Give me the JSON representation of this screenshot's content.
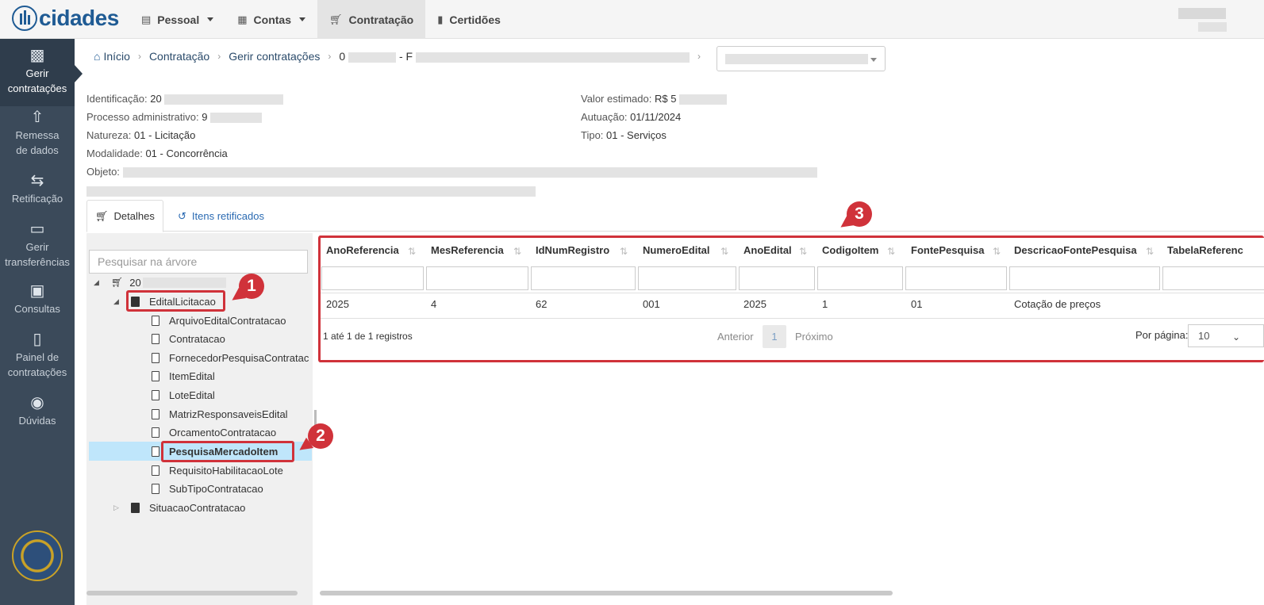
{
  "header": {
    "logo_text": "cidades",
    "nav": [
      {
        "label": "Pessoal",
        "icon": "id-card-icon"
      },
      {
        "label": "Contas",
        "icon": "calendar-icon"
      },
      {
        "label": "Contratação",
        "icon": "cart-icon"
      },
      {
        "label": "Certidões",
        "icon": "file-icon"
      }
    ]
  },
  "sidebar": {
    "items": [
      {
        "label_1": "Gerir",
        "label_2": "contratações",
        "icon": "building-icon"
      },
      {
        "label_1": "Remessa",
        "label_2": "de dados",
        "icon": "upload-icon"
      },
      {
        "label_1": "Retificação",
        "label_2": "",
        "icon": "swap-icon"
      },
      {
        "label_1": "Gerir",
        "label_2": "transferências",
        "icon": "folder-icon"
      },
      {
        "label_1": "Consultas",
        "label_2": "",
        "icon": "book-icon"
      },
      {
        "label_1": "Painel de",
        "label_2": "contratações",
        "icon": "document-icon"
      },
      {
        "label_1": "Dúvidas",
        "label_2": "",
        "icon": "question-icon"
      }
    ]
  },
  "breadcrumb": {
    "home": "Início",
    "level1": "Contratação",
    "level2": "Gerir contratações",
    "level3_prefix": "0",
    "level3_mid": "- F"
  },
  "info": {
    "identificacao_label": "Identificação:",
    "identificacao_value": "20",
    "processo_label": "Processo administrativo:",
    "processo_value": "9",
    "natureza_label": "Natureza:",
    "natureza_value": "01 - Licitação",
    "modalidade_label": "Modalidade:",
    "modalidade_value": "01 - Concorrência",
    "objeto_label": "Objeto:",
    "valor_label": "Valor estimado:",
    "valor_value": "R$ 5",
    "autuacao_label": "Autuação:",
    "autuacao_value": "01/11/2024",
    "tipo_label": "Tipo:",
    "tipo_value": "01 - Serviços"
  },
  "tabs": {
    "detalhes": "Detalhes",
    "itens": "Itens retificados"
  },
  "tree": {
    "search_placeholder": "Pesquisar na árvore",
    "root": "20",
    "edital": "EditalLicitacao",
    "children": [
      "ArquivoEditalContratacao",
      "Contratacao",
      "FornecedorPesquisaContratac",
      "ItemEdital",
      "LoteEdital",
      "MatrizResponsaveisEdital",
      "OrcamentoContratacao",
      "PesquisaMercadoItem",
      "RequisitoHabilitacaoLote",
      "SubTipoContratacao"
    ],
    "situacao": "SituacaoContratacao"
  },
  "grid": {
    "columns": [
      "AnoReferencia",
      "MesReferencia",
      "IdNumRegistro",
      "NumeroEdital",
      "AnoEdital",
      "CodigoItem",
      "FontePesquisa",
      "DescricaoFontePesquisa",
      "TabelaReferenc"
    ],
    "rows": [
      [
        "2025",
        "4",
        "62",
        "001",
        "2025",
        "1",
        "01",
        "Cotação de preços",
        ""
      ]
    ],
    "pager_info": "1 até 1 de 1 registros",
    "prev": "Anterior",
    "page": "1",
    "next": "Próximo",
    "per_page_label": "Por página:",
    "per_page_value": "10"
  },
  "annotations": {
    "b1": "1",
    "b2": "2",
    "b3": "3"
  },
  "colors": {
    "sidebar": "#3b4a5a",
    "brand": "#1f5b94",
    "annotation": "#d0323a",
    "selected": "#bfe6fb"
  }
}
